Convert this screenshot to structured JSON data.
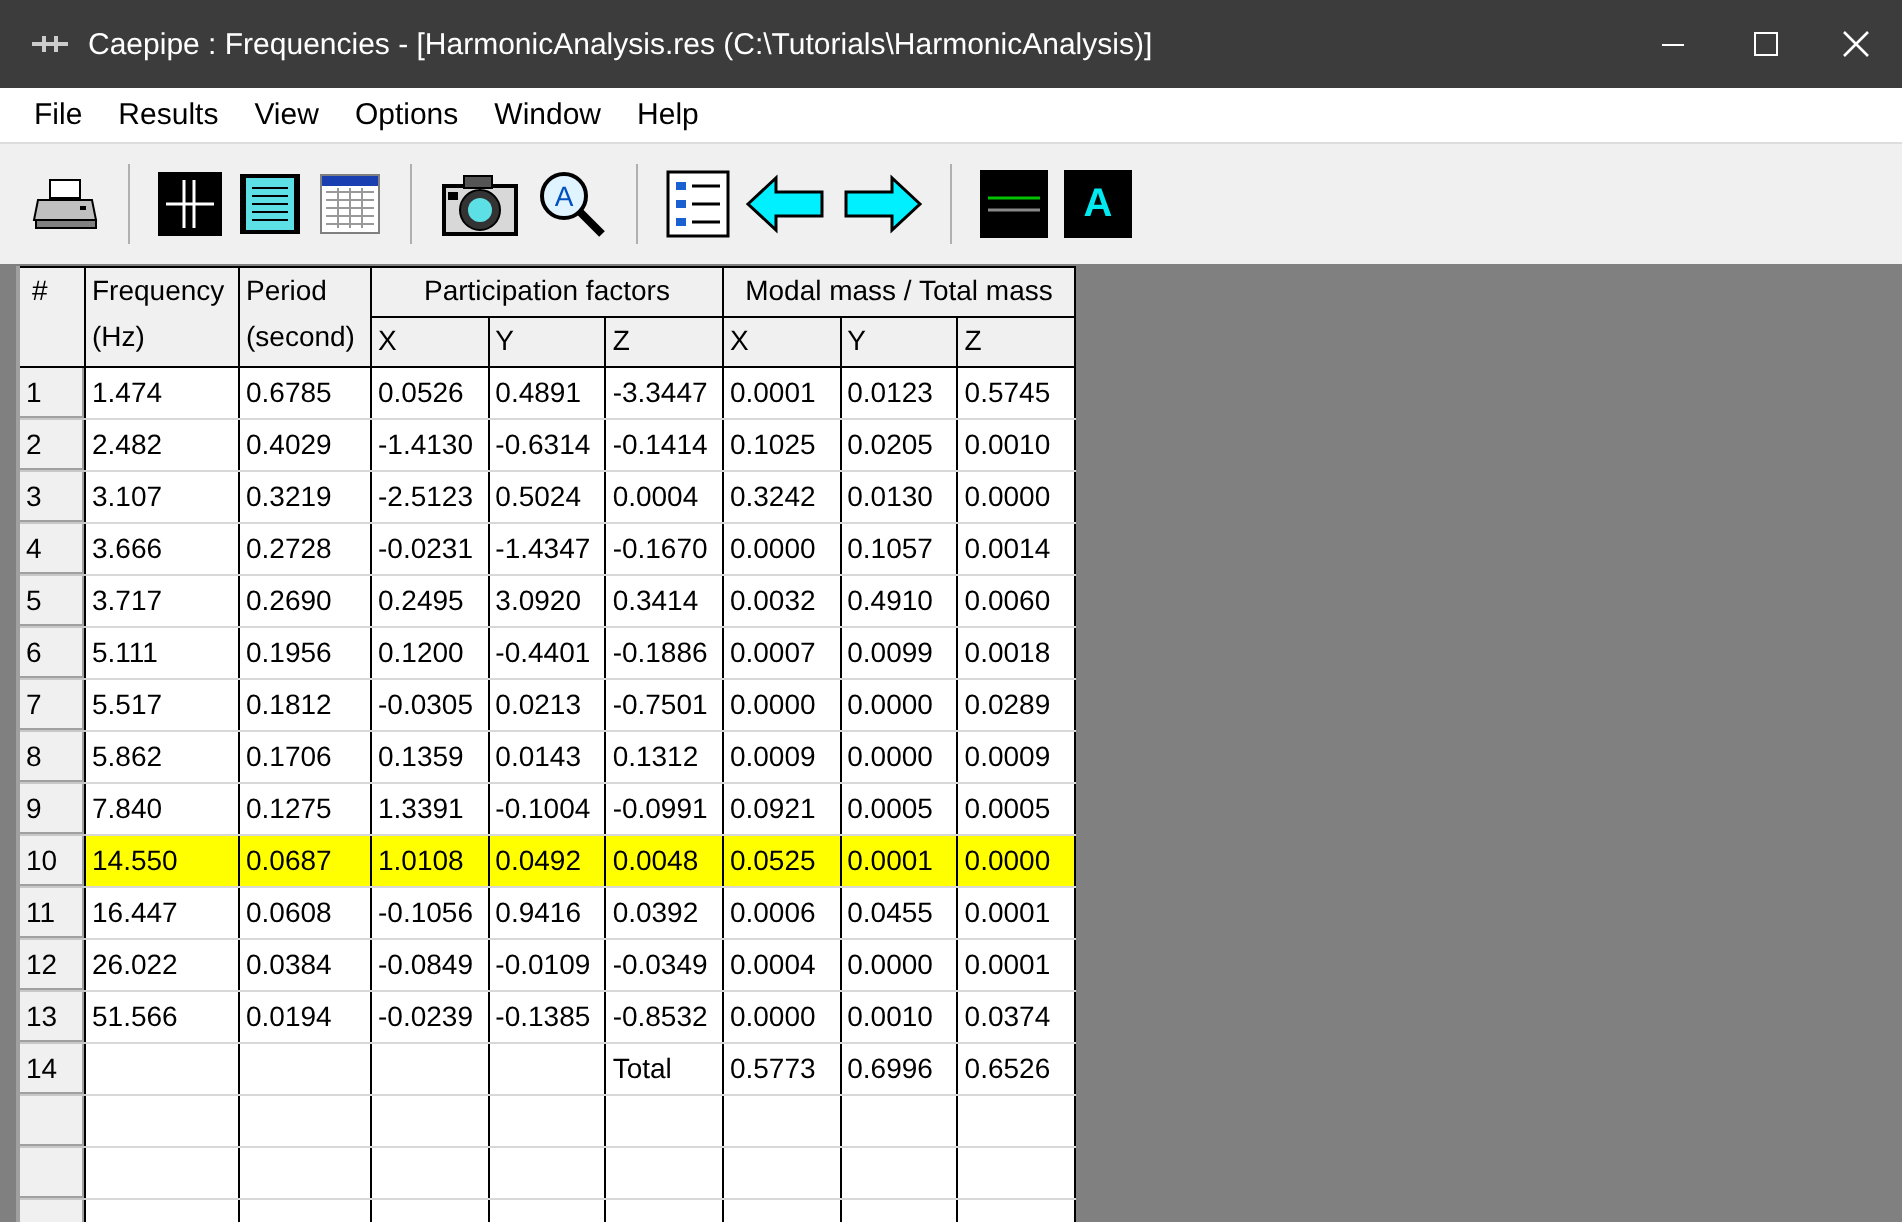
{
  "window": {
    "title": "Caepipe : Frequencies -  [HarmonicAnalysis.res (C:\\Tutorials\\HarmonicAnalysis)]"
  },
  "menu": [
    "File",
    "Results",
    "View",
    "Options",
    "Window",
    "Help"
  ],
  "toolbar": [
    {
      "kind": "printer"
    },
    {
      "kind": "sep"
    },
    {
      "kind": "grid"
    },
    {
      "kind": "text"
    },
    {
      "kind": "table"
    },
    {
      "kind": "sep"
    },
    {
      "kind": "camera"
    },
    {
      "kind": "zoom",
      "glyph": "A"
    },
    {
      "kind": "sep"
    },
    {
      "kind": "list"
    },
    {
      "kind": "left"
    },
    {
      "kind": "right"
    },
    {
      "kind": "sep"
    },
    {
      "kind": "line"
    },
    {
      "kind": "font",
      "glyph": "A"
    }
  ],
  "table": {
    "corner": "#",
    "columns": [
      {
        "title": "Frequency",
        "unit": "(Hz)"
      },
      {
        "title": "Period",
        "unit": "(second)"
      }
    ],
    "groups": [
      {
        "title": "Participation factors",
        "axes": [
          "X",
          "Y",
          "Z"
        ]
      },
      {
        "title": "Modal mass / Total mass",
        "axes": [
          "X",
          "Y",
          "Z"
        ]
      }
    ],
    "rows": [
      {
        "kind": "mode",
        "number": "1",
        "frequency": "1.474",
        "period": "0.6785",
        "factors": [
          "0.0526",
          "0.4891",
          "-3.3447"
        ],
        "mass": [
          "0.0001",
          "0.0123",
          "0.5745"
        ],
        "selected": false
      },
      {
        "kind": "mode",
        "number": "2",
        "frequency": "2.482",
        "period": "0.4029",
        "factors": [
          "-1.4130",
          "-0.6314",
          "-0.1414"
        ],
        "mass": [
          "0.1025",
          "0.0205",
          "0.0010"
        ],
        "selected": false
      },
      {
        "kind": "mode",
        "number": "3",
        "frequency": "3.107",
        "period": "0.3219",
        "factors": [
          "-2.5123",
          "0.5024",
          "0.0004"
        ],
        "mass": [
          "0.3242",
          "0.0130",
          "0.0000"
        ],
        "selected": false
      },
      {
        "kind": "mode",
        "number": "4",
        "frequency": "3.666",
        "period": "0.2728",
        "factors": [
          "-0.0231",
          "-1.4347",
          "-0.1670"
        ],
        "mass": [
          "0.0000",
          "0.1057",
          "0.0014"
        ],
        "selected": false
      },
      {
        "kind": "mode",
        "number": "5",
        "frequency": "3.717",
        "period": "0.2690",
        "factors": [
          "0.2495",
          "3.0920",
          "0.3414"
        ],
        "mass": [
          "0.0032",
          "0.4910",
          "0.0060"
        ],
        "selected": false
      },
      {
        "kind": "mode",
        "number": "6",
        "frequency": "5.111",
        "period": "0.1956",
        "factors": [
          "0.1200",
          "-0.4401",
          "-0.1886"
        ],
        "mass": [
          "0.0007",
          "0.0099",
          "0.0018"
        ],
        "selected": false
      },
      {
        "kind": "mode",
        "number": "7",
        "frequency": "5.517",
        "period": "0.1812",
        "factors": [
          "-0.0305",
          "0.0213",
          "-0.7501"
        ],
        "mass": [
          "0.0000",
          "0.0000",
          "0.0289"
        ],
        "selected": false
      },
      {
        "kind": "mode",
        "number": "8",
        "frequency": "5.862",
        "period": "0.1706",
        "factors": [
          "0.1359",
          "0.0143",
          "0.1312"
        ],
        "mass": [
          "0.0009",
          "0.0000",
          "0.0009"
        ],
        "selected": false
      },
      {
        "kind": "mode",
        "number": "9",
        "frequency": "7.840",
        "period": "0.1275",
        "factors": [
          "1.3391",
          "-0.1004",
          "-0.0991"
        ],
        "mass": [
          "0.0921",
          "0.0005",
          "0.0005"
        ],
        "selected": false
      },
      {
        "kind": "mode",
        "number": "10",
        "frequency": "14.550",
        "period": "0.0687",
        "factors": [
          "1.0108",
          "0.0492",
          "0.0048"
        ],
        "mass": [
          "0.0525",
          "0.0001",
          "0.0000"
        ],
        "selected": true
      },
      {
        "kind": "mode",
        "number": "11",
        "frequency": "16.447",
        "period": "0.0608",
        "factors": [
          "-0.1056",
          "0.9416",
          "0.0392"
        ],
        "mass": [
          "0.0006",
          "0.0455",
          "0.0001"
        ],
        "selected": false
      },
      {
        "kind": "mode",
        "number": "12",
        "frequency": "26.022",
        "period": "0.0384",
        "factors": [
          "-0.0849",
          "-0.0109",
          "-0.0349"
        ],
        "mass": [
          "0.0004",
          "0.0000",
          "0.0001"
        ],
        "selected": false
      },
      {
        "kind": "mode",
        "number": "13",
        "frequency": "51.566",
        "period": "0.0194",
        "factors": [
          "-0.0239",
          "-0.1385",
          "-0.8532"
        ],
        "mass": [
          "0.0000",
          "0.0010",
          "0.0374"
        ],
        "selected": false
      },
      {
        "kind": "total",
        "number": "14",
        "label": "Total",
        "mass": [
          "0.5773",
          "0.6996",
          "0.6526"
        ]
      }
    ]
  }
}
